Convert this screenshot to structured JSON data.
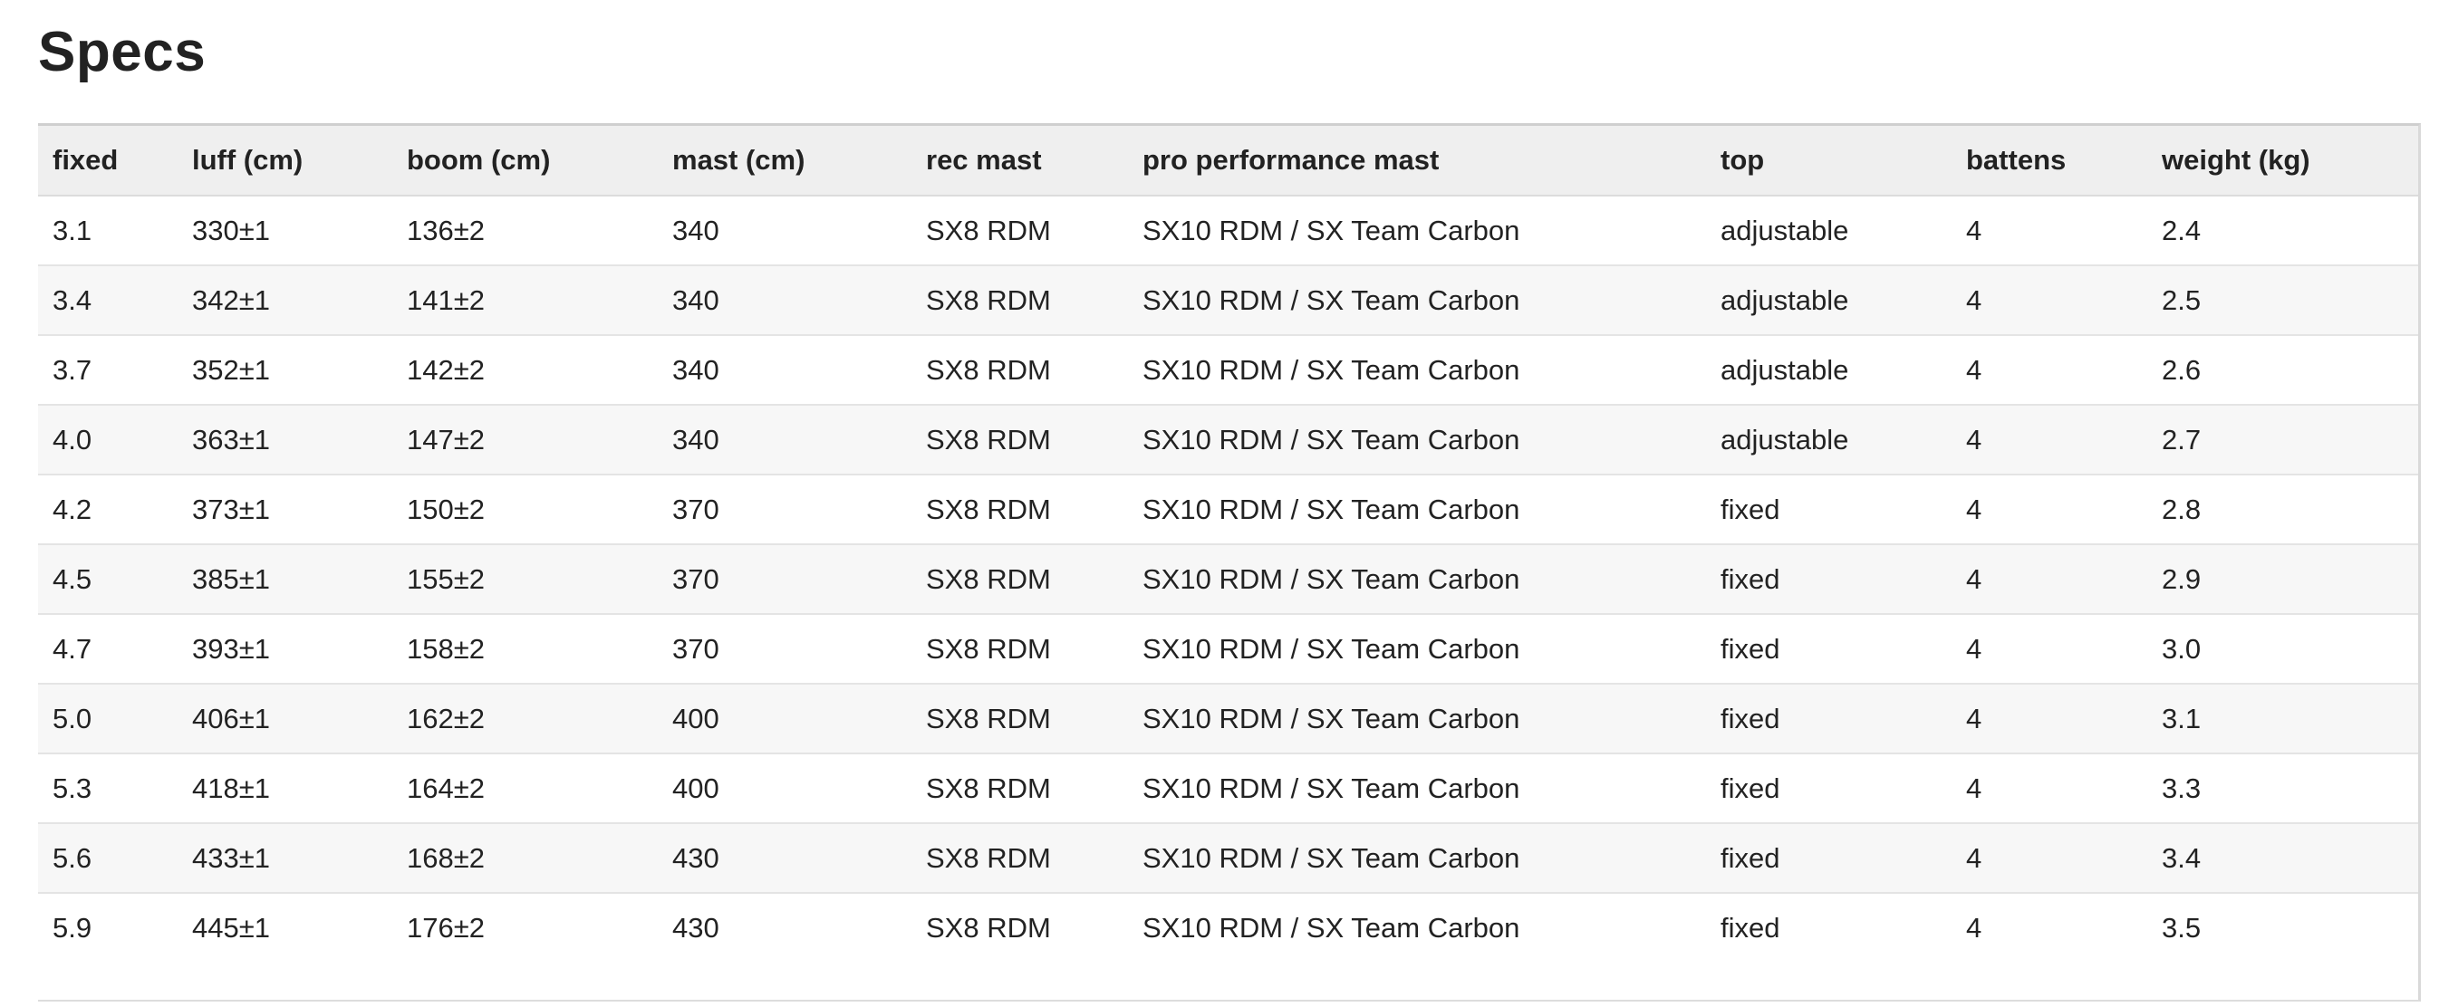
{
  "page": {
    "title": "Specs"
  },
  "table": {
    "headers": [
      "fixed",
      "luff (cm)",
      "boom (cm)",
      "mast (cm)",
      "rec mast",
      "pro performance mast",
      "top",
      "battens",
      "weight (kg)"
    ],
    "rows": [
      [
        "3.1",
        "330±1",
        "136±2",
        "340",
        "SX8 RDM",
        "SX10 RDM / SX Team Carbon",
        "adjustable",
        "4",
        "2.4"
      ],
      [
        "3.4",
        "342±1",
        "141±2",
        "340",
        "SX8 RDM",
        "SX10 RDM / SX Team Carbon",
        "adjustable",
        "4",
        "2.5"
      ],
      [
        "3.7",
        "352±1",
        "142±2",
        "340",
        "SX8 RDM",
        "SX10 RDM / SX Team Carbon",
        "adjustable",
        "4",
        "2.6"
      ],
      [
        "4.0",
        "363±1",
        "147±2",
        "340",
        "SX8 RDM",
        "SX10 RDM / SX Team Carbon",
        "adjustable",
        "4",
        "2.7"
      ],
      [
        "4.2",
        "373±1",
        "150±2",
        "370",
        "SX8 RDM",
        "SX10 RDM / SX Team Carbon",
        "fixed",
        "4",
        "2.8"
      ],
      [
        "4.5",
        "385±1",
        "155±2",
        "370",
        "SX8 RDM",
        "SX10 RDM / SX Team Carbon",
        "fixed",
        "4",
        "2.9"
      ],
      [
        "4.7",
        "393±1",
        "158±2",
        "370",
        "SX8 RDM",
        "SX10 RDM / SX Team Carbon",
        "fixed",
        "4",
        "3.0"
      ],
      [
        "5.0",
        "406±1",
        "162±2",
        "400",
        "SX8 RDM",
        "SX10 RDM / SX Team Carbon",
        "fixed",
        "4",
        "3.1"
      ],
      [
        "5.3",
        "418±1",
        "164±2",
        "400",
        "SX8 RDM",
        "SX10 RDM / SX Team Carbon",
        "fixed",
        "4",
        "3.3"
      ],
      [
        "5.6",
        "433±1",
        "168±2",
        "430",
        "SX8 RDM",
        "SX10 RDM / SX Team Carbon",
        "fixed",
        "4",
        "3.4"
      ],
      [
        "5.9",
        "445±1",
        "176±2",
        "430",
        "SX8 RDM",
        "SX10 RDM / SX Team Carbon",
        "fixed",
        "4",
        "3.5"
      ]
    ]
  }
}
